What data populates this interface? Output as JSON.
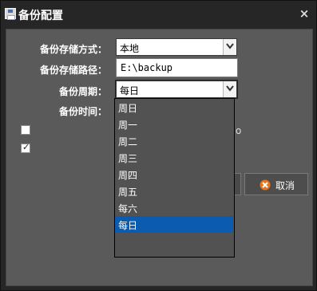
{
  "window": {
    "title": "备份配置",
    "close_label": "×"
  },
  "form": {
    "storage_mode": {
      "label": "备份存储方式：",
      "value": "本地"
    },
    "storage_path": {
      "label": "备份存储路径：",
      "value": "E:\\backup"
    },
    "period": {
      "label": "备份周期：",
      "value": "每日"
    },
    "time": {
      "label": "备份时间："
    },
    "options": [
      {
        "checked": false
      },
      {
        "checked": true
      }
    ],
    "partial_text": "o"
  },
  "dropdown": {
    "items": [
      "周日",
      "周一",
      "周二",
      "周三",
      "周四",
      "周五",
      "每六",
      "每日"
    ],
    "selected_index": 7
  },
  "buttons": {
    "cancel_label": "取消"
  },
  "colors": {
    "selection": "#0b5bb0",
    "panel": "#5a5a5a",
    "titlebar": "#262626",
    "cancel_icon": "#e8731a"
  }
}
